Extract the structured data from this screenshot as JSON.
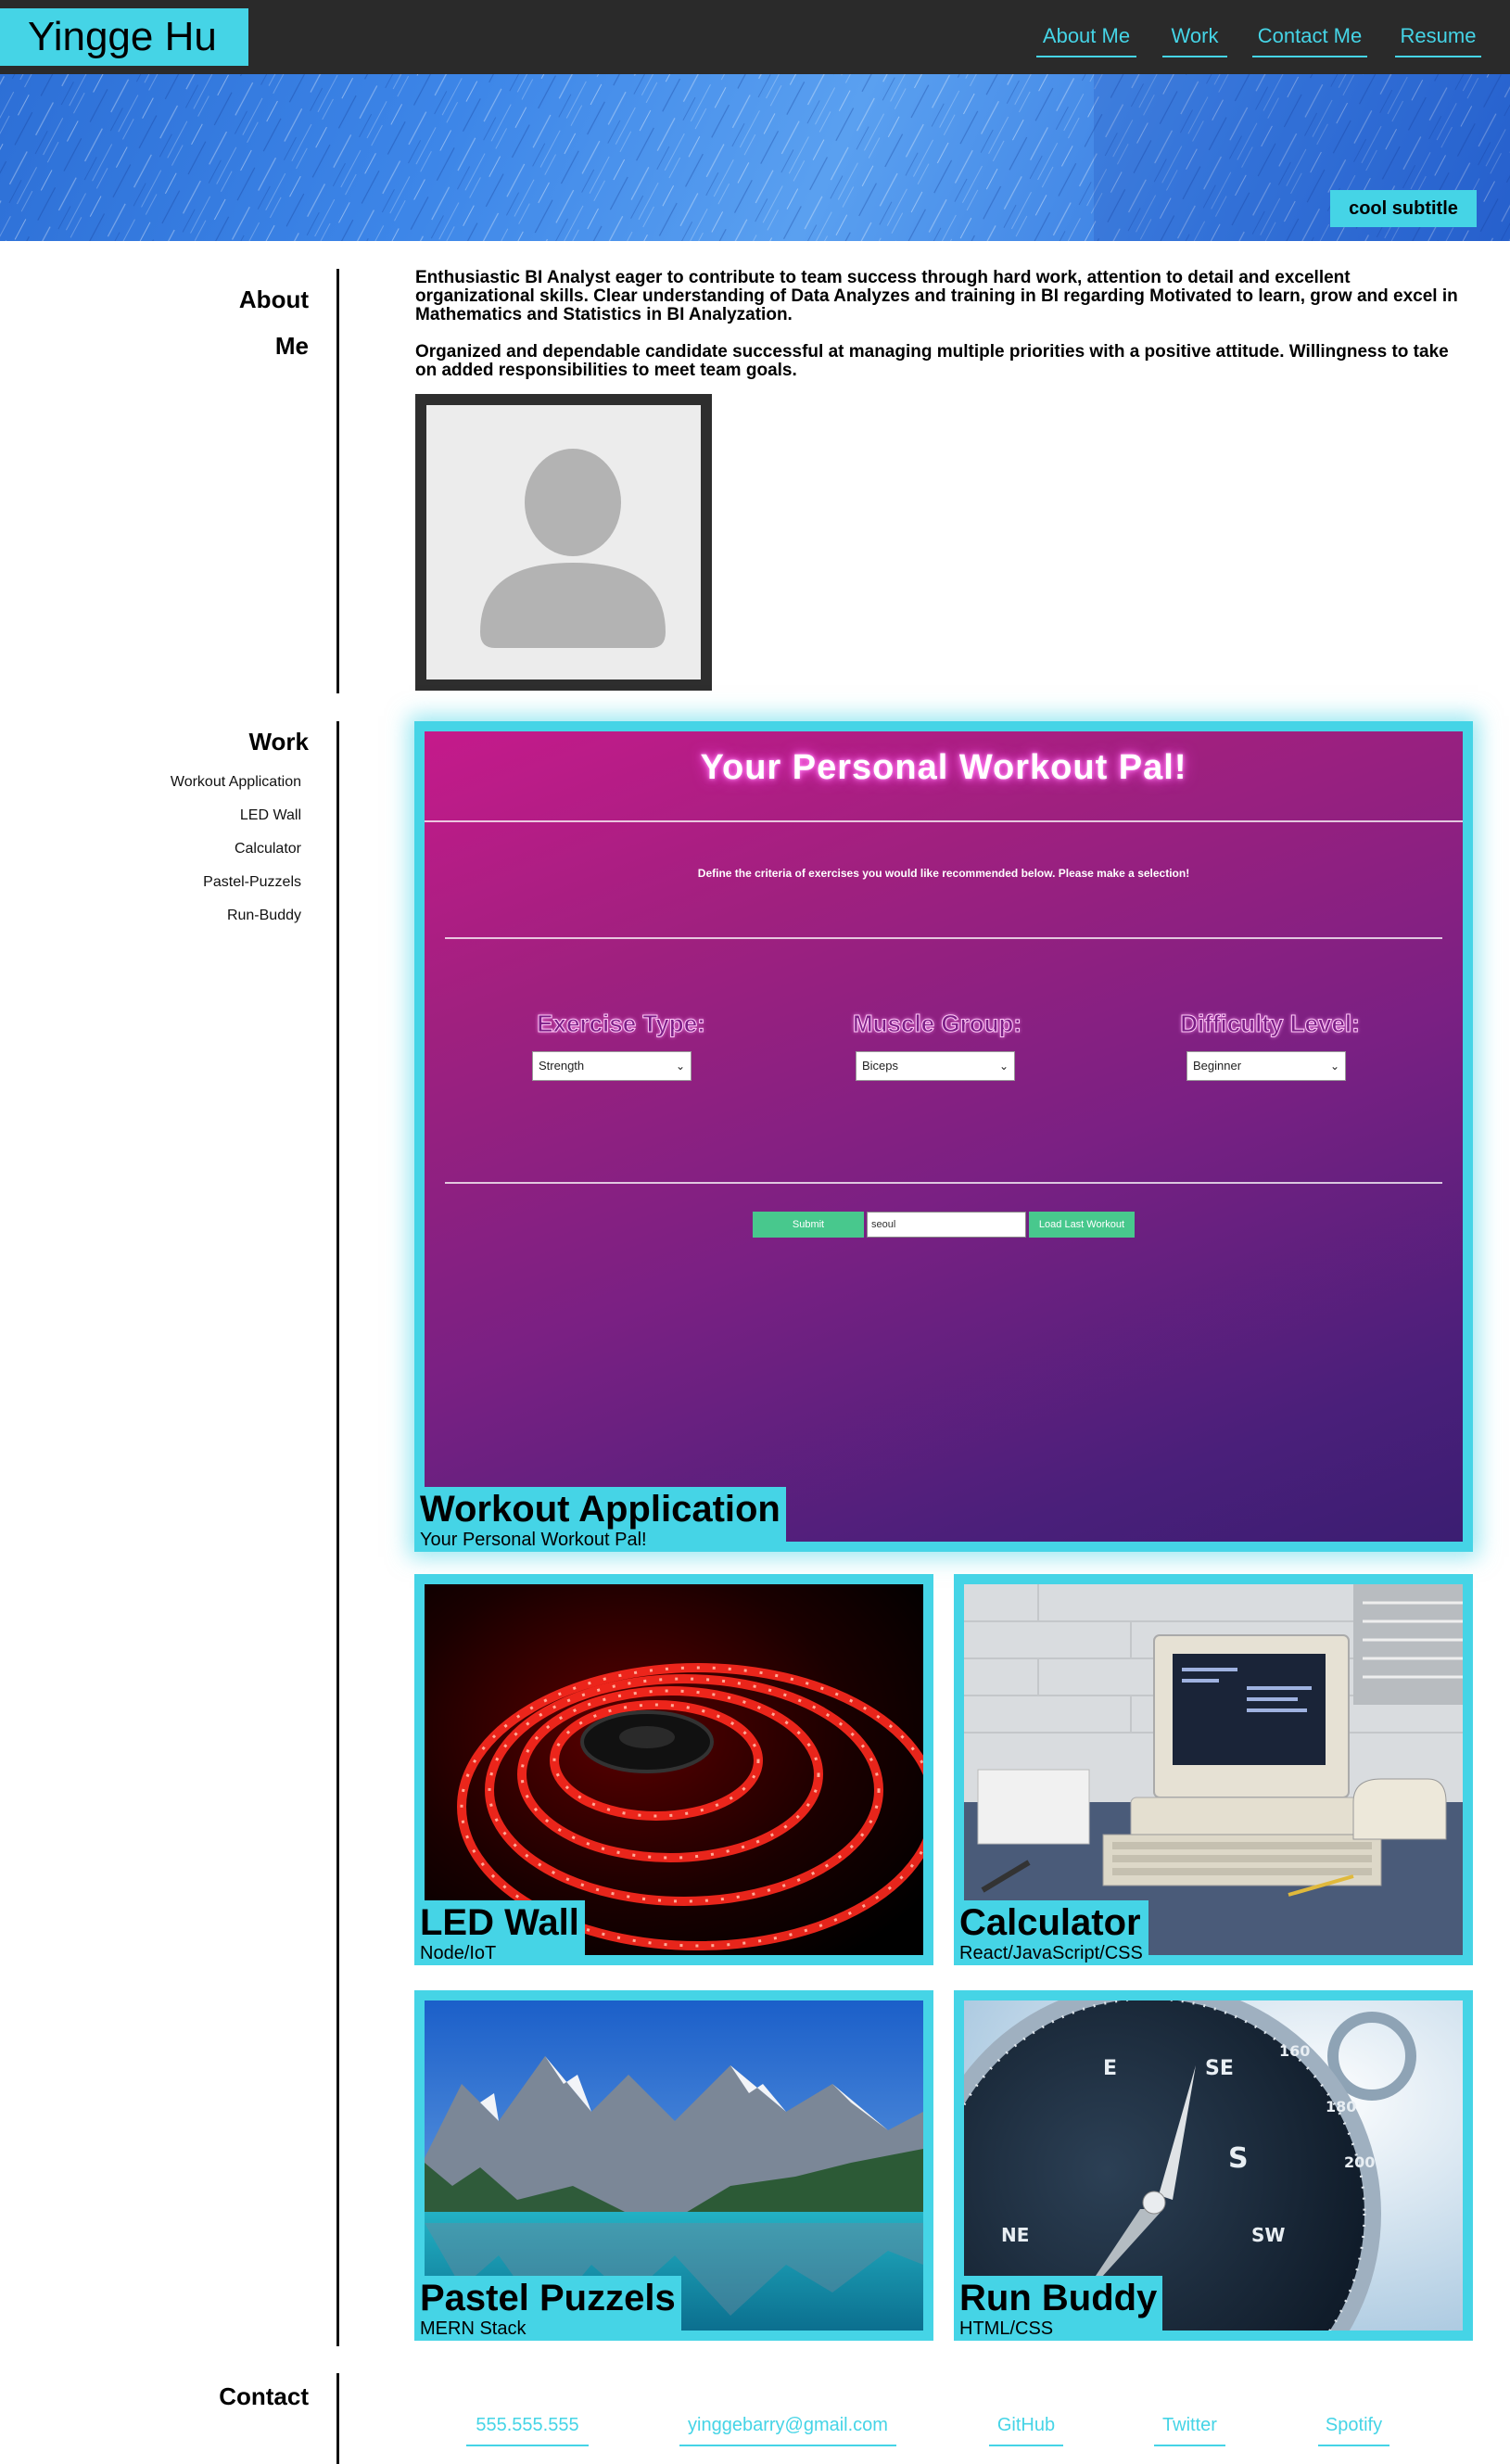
{
  "header": {
    "name": "Yingge Hu",
    "nav": [
      "About Me",
      "Work",
      "Contact Me",
      "Resume"
    ]
  },
  "hero": {
    "subtitle": "cool subtitle"
  },
  "about": {
    "title_line1": "About",
    "title_line2": "Me",
    "paragraph1": "Enthusiastic BI Analyst eager to contribute to team success through hard work, attention to detail and excellent organizational skills. Clear understanding of Data Analyzes and training in BI regarding Motivated to learn, grow and excel in Mathematics and Statistics in BI Analyzation.",
    "paragraph2": "Organized and dependable candidate successful at managing multiple priorities with a positive attitude. Willingness to take on added responsibilities to meet team goals."
  },
  "work": {
    "title": "Work",
    "links": [
      "Workout Application",
      "LED Wall",
      "Calculator",
      "Pastel-Puzzels",
      "Run-Buddy"
    ],
    "featured": {
      "title": "Workout Application",
      "subtitle": "Your Personal Workout Pal!",
      "screenshot": {
        "heading": "Your Personal Workout Pal!",
        "description": "Define the criteria of exercises you would like recommended below. Please make a selection!",
        "labels": [
          "Exercise Type:",
          "Muscle Group:",
          "Difficulty Level:"
        ],
        "selects": [
          "Strength",
          "Biceps",
          "Beginner"
        ],
        "submit": "Submit",
        "input_value": "seoul",
        "load_last": "Load Last Workout"
      }
    },
    "projects": [
      {
        "title": "LED Wall",
        "subtitle": "Node/IoT"
      },
      {
        "title": "Calculator",
        "subtitle": "React/JavaScript/CSS"
      },
      {
        "title": "Pastel Puzzels",
        "subtitle": "MERN Stack"
      },
      {
        "title": "Run Buddy",
        "subtitle": "HTML/CSS"
      }
    ]
  },
  "contact": {
    "title": "Contact",
    "links": [
      "555.555.555",
      "yinggebarry@gmail.com",
      "GitHub",
      "Twitter",
      "Spotify"
    ]
  },
  "colors": {
    "accent": "#45d4e6",
    "dark": "#2a2a2a"
  }
}
